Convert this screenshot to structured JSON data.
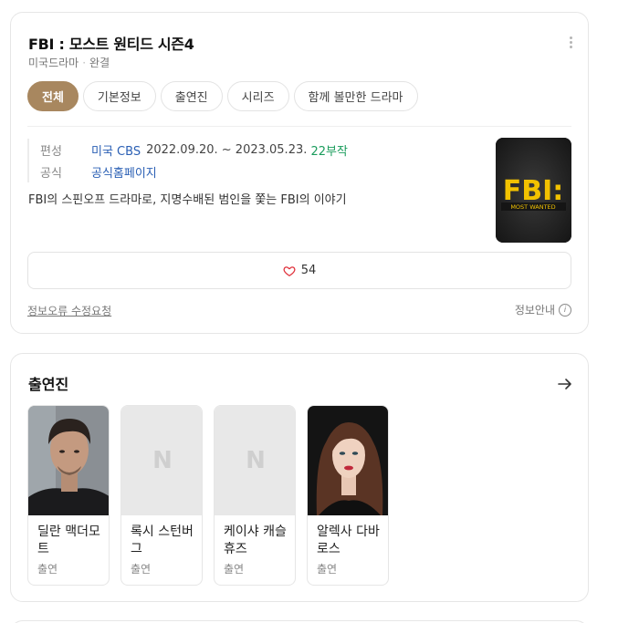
{
  "show": {
    "title": "FBI : 모스트 원티드 시즌4",
    "genre": "미국드라마",
    "status": "완결",
    "more_icon": "more-vertical-icon"
  },
  "tabs": [
    {
      "label": "전체",
      "active": true
    },
    {
      "label": "기본정보",
      "active": false
    },
    {
      "label": "출연진",
      "active": false
    },
    {
      "label": "시리즈",
      "active": false
    },
    {
      "label": "함께 볼만한 드라마",
      "active": false
    }
  ],
  "meta": {
    "broadcast_key": "편성",
    "network": "미국 CBS",
    "period": "2022.09.20. ~ 2023.05.23.",
    "episodes": "22부작",
    "official_key": "공식",
    "official_link": "공식홈페이지"
  },
  "description": "FBI의 스핀오프 드라마로, 지명수배된 범인을 쫓는 FBI의 이야기",
  "poster": {
    "logo_text": "FBI:",
    "sub_text": "MOST WANTED"
  },
  "like": {
    "count": "54",
    "icon": "heart-icon"
  },
  "footer": {
    "report_link": "정보오류 수정요청",
    "info_label": "정보안내",
    "info_glyph": "i"
  },
  "cast": {
    "section_title": "출연진",
    "more_icon": "arrow-right-icon",
    "members": [
      {
        "name": "딜란 맥더모트",
        "role": "출연",
        "photo": "photo"
      },
      {
        "name": "록시 스턴버그",
        "role": "출연",
        "photo": "placeholder",
        "placeholder_glyph": "N"
      },
      {
        "name": "케이샤 캐슬 휴즈",
        "role": "출연",
        "photo": "placeholder",
        "placeholder_glyph": "N"
      },
      {
        "name": "알렉사 다바로스",
        "role": "출연",
        "photo": "photo"
      }
    ]
  },
  "colors": {
    "accent_tab": "#a8875f",
    "link_blue": "#2a5fb4",
    "episodes_green": "#1a9c5c",
    "heart_red": "#e0323c",
    "poster_yellow": "#f2c200"
  }
}
